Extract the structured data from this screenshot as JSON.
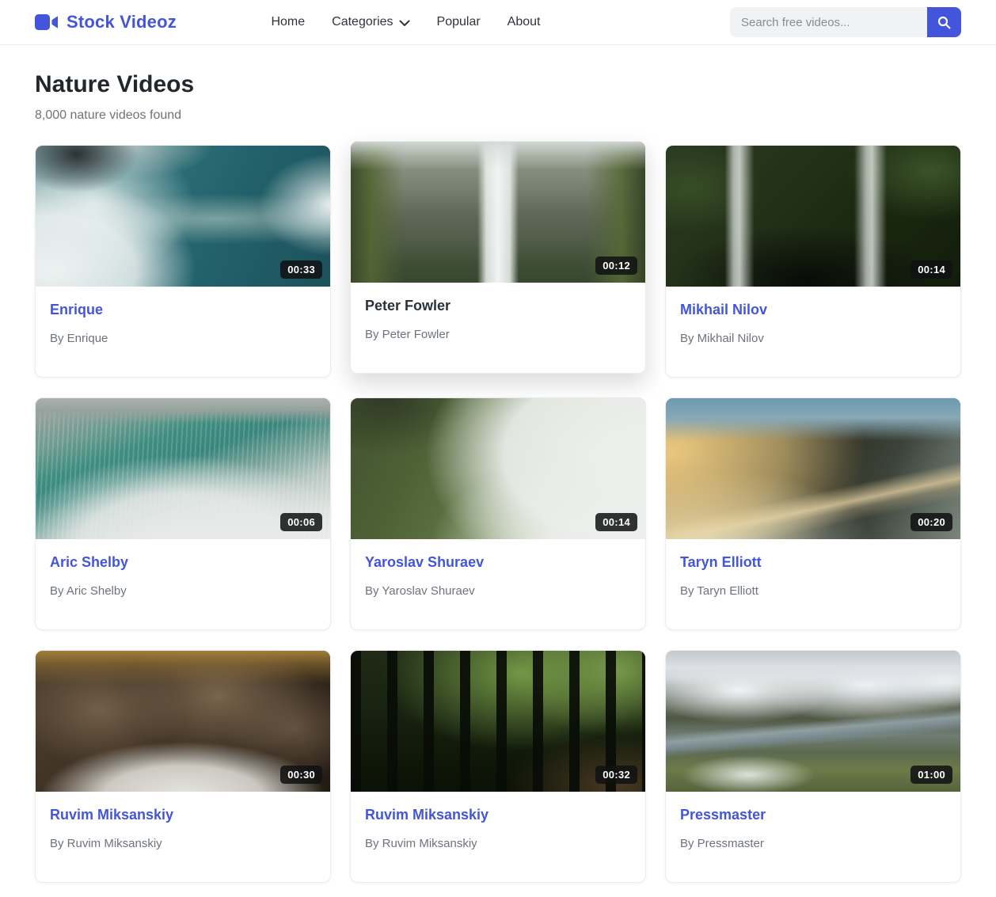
{
  "header": {
    "brand": "Stock Videoz",
    "nav": [
      {
        "label": "Home",
        "dropdown": false
      },
      {
        "label": "Categories",
        "dropdown": true
      },
      {
        "label": "Popular",
        "dropdown": false
      },
      {
        "label": "About",
        "dropdown": false
      }
    ],
    "search": {
      "placeholder": "Search free videos..."
    }
  },
  "page": {
    "title": "Nature Videos",
    "results_text": "8,000 nature videos found"
  },
  "videos": [
    {
      "title": "Enrique",
      "byline": "By Enrique",
      "duration": "00:33",
      "thumb_desc": "aerial view of teal ocean waves with white foam",
      "highlighted": false
    },
    {
      "title": "Peter Fowler",
      "byline": "By Peter Fowler",
      "duration": "00:12",
      "thumb_desc": "waterfall in lush mossy green forest",
      "highlighted": true
    },
    {
      "title": "Mikhail Nilov",
      "byline": "By Mikhail Nilov",
      "duration": "00:14",
      "thumb_desc": "twin waterfalls in dark jungle",
      "highlighted": false
    },
    {
      "title": "Aric Shelby",
      "byline": "By Aric Shelby",
      "duration": "00:06",
      "thumb_desc": "horseshoe waterfall edge with rising mist",
      "highlighted": false
    },
    {
      "title": "Yaroslav Shuraev",
      "byline": "By Yaroslav Shuraev",
      "duration": "00:14",
      "thumb_desc": "green mountain ridge wrapped in clouds",
      "highlighted": false
    },
    {
      "title": "Taryn Elliott",
      "byline": "By Taryn Elliott",
      "duration": "00:20",
      "thumb_desc": "coastal mountain at golden sunset with surf",
      "highlighted": false
    },
    {
      "title": "Ruvim Miksanskiy",
      "byline": "By Ruvim Miksanskiy",
      "duration": "00:30",
      "thumb_desc": "rocky forest stream with boulders",
      "highlighted": false
    },
    {
      "title": "Ruvim Miksanskiy",
      "byline": "By Ruvim Miksanskiy",
      "duration": "00:32",
      "thumb_desc": "dark forest with sunlit green canopy",
      "highlighted": false
    },
    {
      "title": "Pressmaster",
      "byline": "By Pressmaster",
      "duration": "01:00",
      "thumb_desc": "snow-capped mountain range above a green valley",
      "highlighted": false
    }
  ],
  "icons": {
    "logo": "video-camera-icon",
    "categories": "chevron-down-icon",
    "search": "search-icon"
  },
  "colors": {
    "accent": "#4355db",
    "badge_bg": "#101113",
    "muted_text": "#6d737b"
  }
}
